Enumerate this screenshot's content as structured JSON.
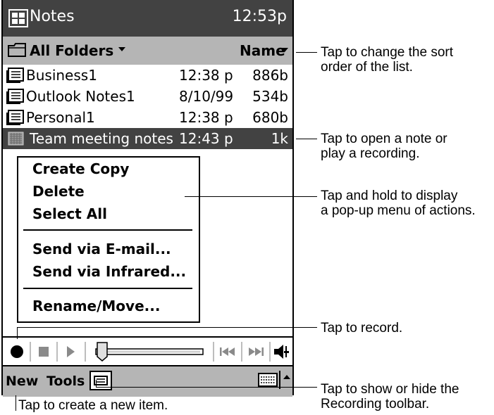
{
  "titlebar": {
    "app_title": "Notes",
    "clock": "12:53p",
    "icon": "start-flag-icon"
  },
  "folderbar": {
    "folder": "All Folders",
    "sort": "Name"
  },
  "notes": [
    {
      "name": "Business1",
      "date": "12:38 p",
      "size": "886b"
    },
    {
      "name": "Outlook Notes1",
      "date": "8/10/99",
      "size": "534b"
    },
    {
      "name": "Personal1",
      "date": "12:38 p",
      "size": "680b"
    },
    {
      "name": "Team meeting notes",
      "date": "12:43 p",
      "size": "1k"
    }
  ],
  "context_menu": {
    "create_copy": "Create Copy",
    "delete": "Delete",
    "select_all": "Select All",
    "send_email": "Send via E-mail...",
    "send_infrared": "Send via Infrared...",
    "rename_move": "Rename/Move..."
  },
  "bottombar": {
    "new": "New",
    "tools": "Tools"
  },
  "callouts": {
    "sort": [
      "Tap to change the sort",
      "order of the list."
    ],
    "open": [
      "Tap to open a note or",
      "play a recording."
    ],
    "hold": [
      "Tap and hold to display",
      "a pop-up menu of actions."
    ],
    "record": "Tap to record.",
    "toolbar": [
      "Tap to show or hide the",
      "Recording toolbar."
    ],
    "new_item": "Tap to create a new  item."
  },
  "colors": {
    "titlebar": "#424242",
    "bar": "#b5b5b5",
    "selection": "#424242"
  }
}
